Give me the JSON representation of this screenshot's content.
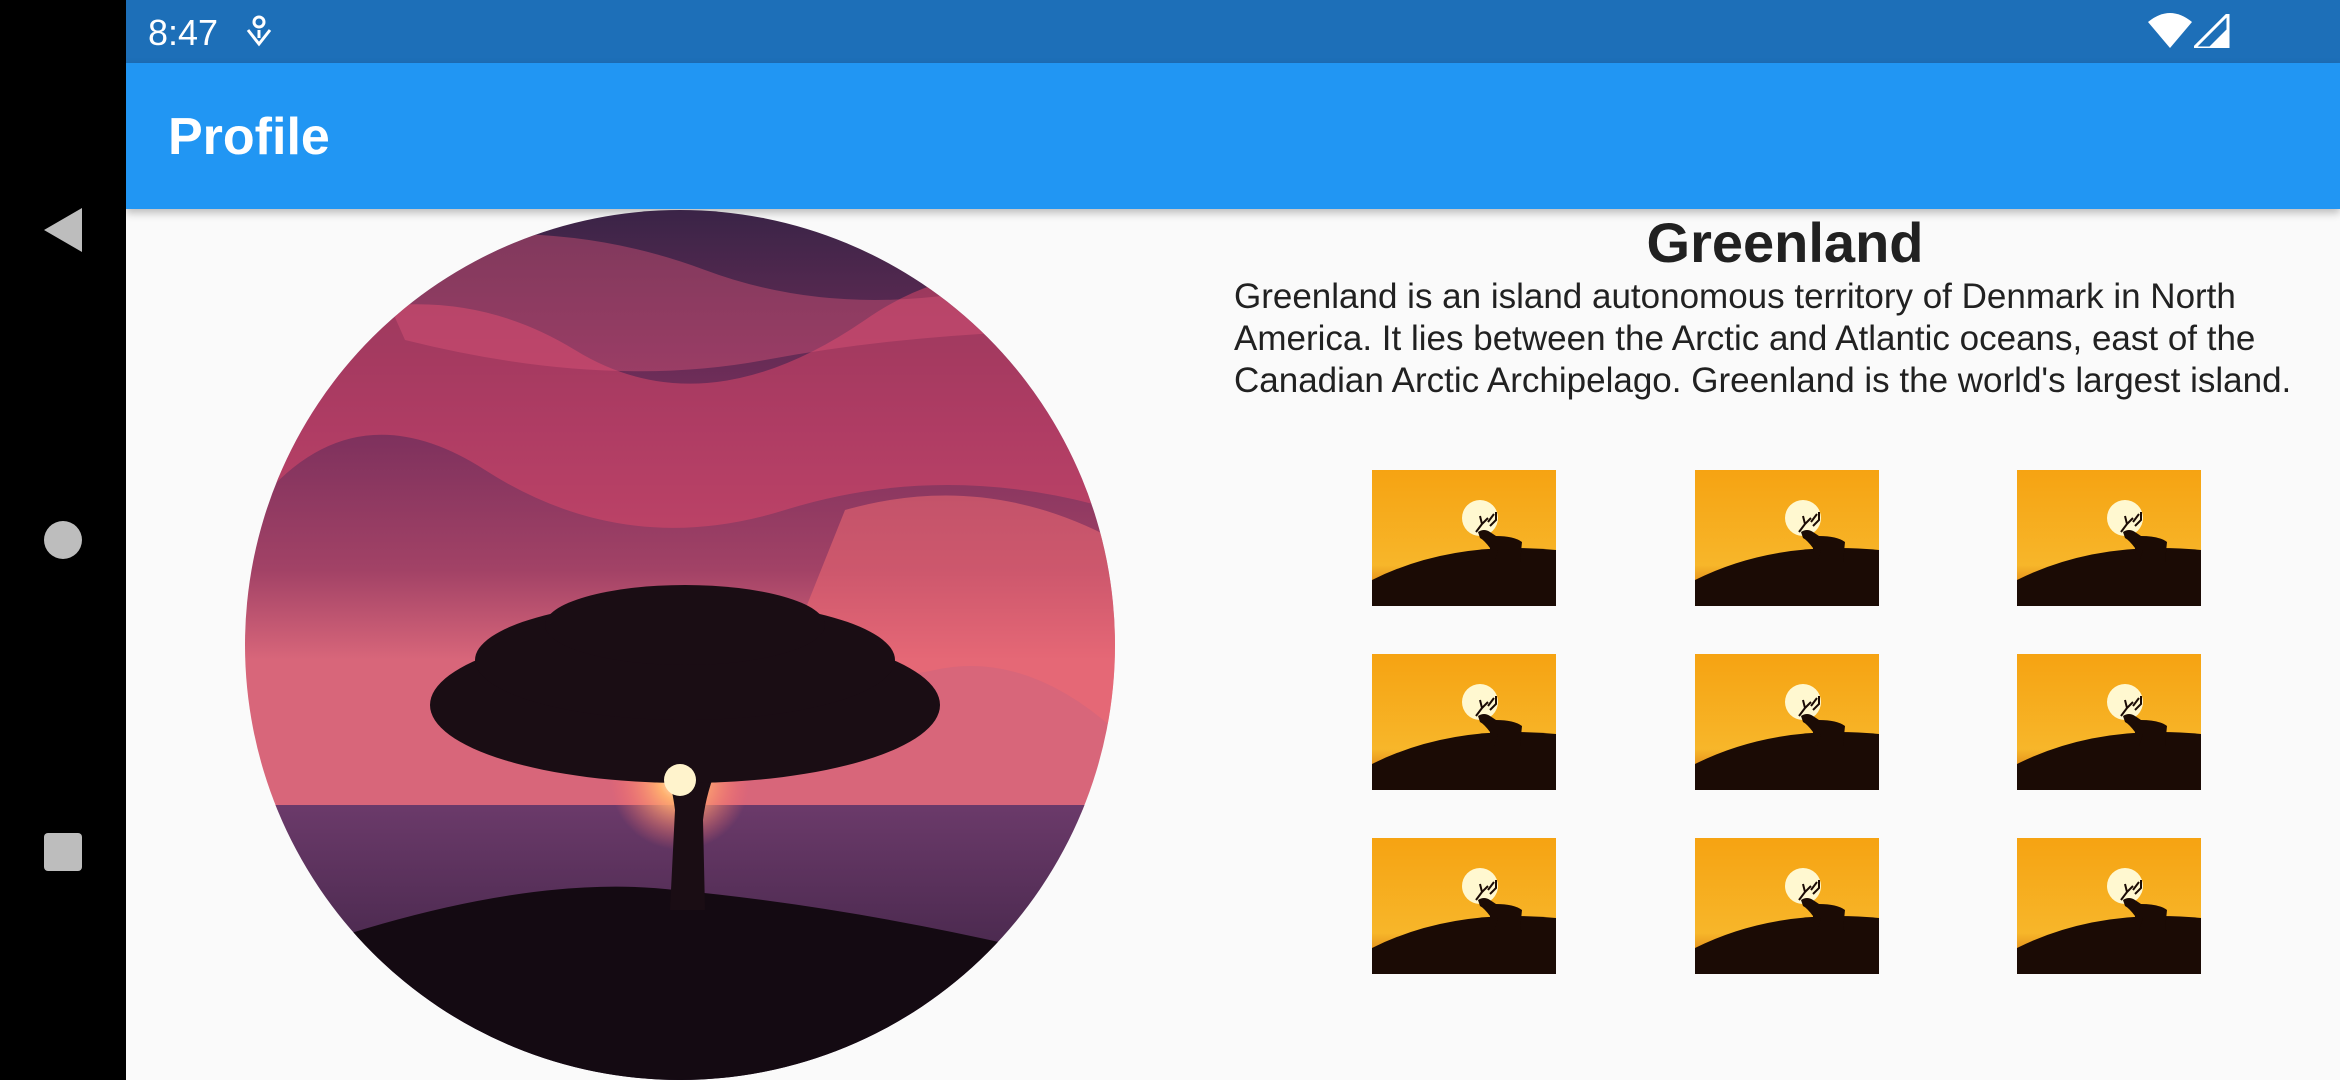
{
  "status_bar": {
    "time": "8:47",
    "icons": [
      "notification-icon",
      "wifi-icon",
      "signal-icon"
    ]
  },
  "app_bar": {
    "title": "Profile",
    "color": "#2196f3"
  },
  "profile": {
    "name": "Greenland",
    "description": "Greenland is an island autonomous territory of Denmark in North America. It lies between the Arctic and Atlantic oceans, east of the Canadian Arctic Archipelago. Greenland is the world's largest island.",
    "hero_image": "sunset-tree-image",
    "gallery": [
      {
        "image": "deer-sunset-image"
      },
      {
        "image": "deer-sunset-image"
      },
      {
        "image": "deer-sunset-image"
      },
      {
        "image": "deer-sunset-image"
      },
      {
        "image": "deer-sunset-image"
      },
      {
        "image": "deer-sunset-image"
      },
      {
        "image": "deer-sunset-image"
      },
      {
        "image": "deer-sunset-image"
      },
      {
        "image": "deer-sunset-image"
      }
    ]
  },
  "navigation": {
    "buttons": [
      "back-icon",
      "home-icon",
      "recents-icon"
    ]
  }
}
